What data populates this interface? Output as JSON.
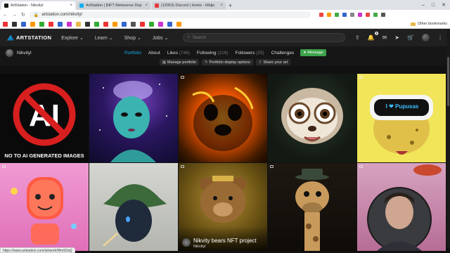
{
  "browser": {
    "tabs": [
      {
        "title": "ArtStation - Nikvityl",
        "color": "#1a1a1a",
        "active": true
      },
      {
        "title": "ArtStation | [NFT Metaverse Dep",
        "color": "#13aff0",
        "active": false
      },
      {
        "title": "(12053) Discord | Home - Midjo",
        "color": "#e33b3b",
        "active": false
      }
    ],
    "new_tab": "+",
    "url": "artstation.com/nikvityl",
    "other_bookmarks": "Other bookmarks",
    "status_url": "https://www.artstation.com/artwork/Wm92aQ"
  },
  "site": {
    "logo": "ARTSTATION",
    "menu": [
      "Explore",
      "Learn",
      "Shop",
      "Jobs"
    ],
    "search_placeholder": "Search",
    "notif_count": "2"
  },
  "profile": {
    "name": "Nikvityl",
    "tabs": [
      {
        "label": "Portfolio",
        "count": ""
      },
      {
        "label": "About",
        "count": ""
      },
      {
        "label": "Likes",
        "count": "(746)"
      },
      {
        "label": "Following",
        "count": "(216)"
      },
      {
        "label": "Followers",
        "count": "(25)"
      },
      {
        "label": "Challenges",
        "count": ""
      }
    ],
    "message_button": "Message",
    "actions": [
      "Manage portfolio",
      "Portfolio display options",
      "Share your art"
    ]
  },
  "artworks": [
    {
      "caption": "NO TO AI GENERATED IMAGES",
      "subtitle": ""
    },
    {
      "caption": "",
      "subtitle": ""
    },
    {
      "caption": "",
      "subtitle": ""
    },
    {
      "caption": "",
      "subtitle": ""
    },
    {
      "caption": "I ❤ Pupusas",
      "subtitle": ""
    },
    {
      "caption": "",
      "subtitle": ""
    },
    {
      "caption": "",
      "subtitle": ""
    },
    {
      "caption": "Nikvity bears NFT project",
      "subtitle": "Nikvityl"
    },
    {
      "caption": "",
      "subtitle": ""
    },
    {
      "caption": "",
      "subtitle": ""
    }
  ]
}
